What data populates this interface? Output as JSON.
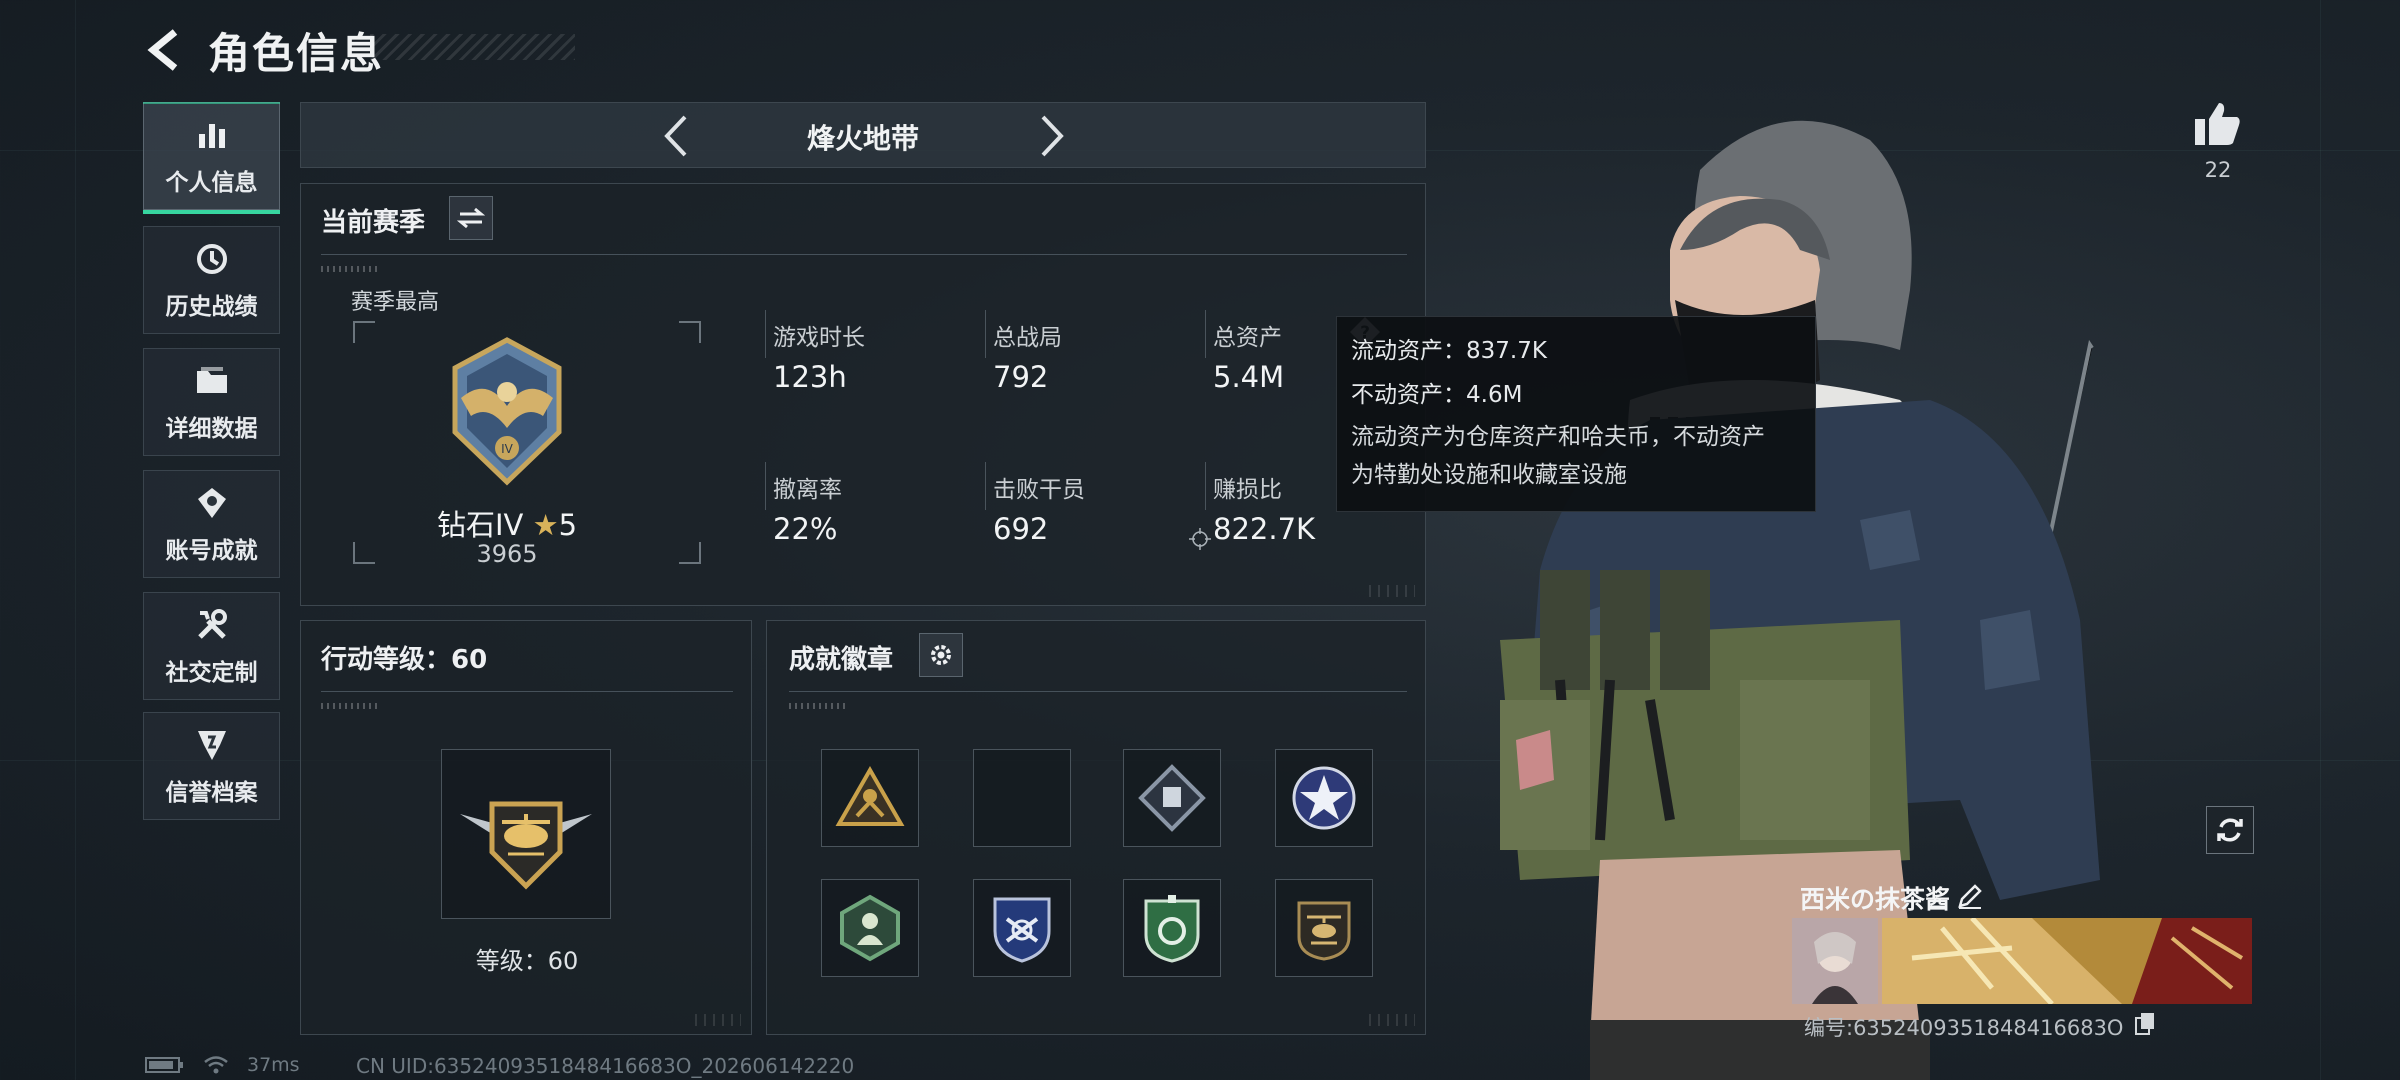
{
  "header": {
    "title": "角色信息"
  },
  "nav": {
    "items": [
      {
        "label": "个人信息",
        "icon": "bar-chart-icon",
        "active": true
      },
      {
        "label": "历史战绩",
        "icon": "clock-history-icon",
        "active": false
      },
      {
        "label": "详细数据",
        "icon": "folder-icon",
        "active": false
      },
      {
        "label": "账号成就",
        "icon": "achievement-icon",
        "active": false
      },
      {
        "label": "社交定制",
        "icon": "tools-icon",
        "active": false
      },
      {
        "label": "信誉档案",
        "icon": "reputation-icon",
        "active": false
      }
    ]
  },
  "mode": {
    "title": "烽火地带"
  },
  "season": {
    "title": "当前赛季",
    "best_label": "赛季最高",
    "rank_name": "钻石IV",
    "rank_stars": "5",
    "rank_score": "3965",
    "stats": [
      {
        "label": "游戏时长",
        "value": "123h"
      },
      {
        "label": "总战局",
        "value": "792"
      },
      {
        "label": "总资产",
        "value": "5.4M"
      },
      {
        "label": "撤离率",
        "value": "22%"
      },
      {
        "label": "击败干员",
        "value": "692"
      },
      {
        "label": "赚损比",
        "value": "822.7K"
      }
    ]
  },
  "tooltip": {
    "liquid": "流动资产：837.7K",
    "fixed": "不动资产：4.6M",
    "desc_line1": "流动资产为仓库资产和哈夫币，不动资产",
    "desc_line2": "为特勤处设施和收藏室设施"
  },
  "action_level": {
    "title": "行动等级：60",
    "level_text": "等级：60"
  },
  "badges": {
    "title": "成就徽章",
    "slots": [
      {
        "icon": "triangle-badge-icon",
        "color": "#c9a14a"
      },
      {
        "icon": "",
        "color": ""
      },
      {
        "icon": "diamond-badge-icon",
        "color": "#8a96a6"
      },
      {
        "icon": "star-badge-icon",
        "color": "#5a6fc4"
      },
      {
        "icon": "hexagon-badge-icon",
        "color": "#6fa77c"
      },
      {
        "icon": "shield-badge-icon",
        "color": "#4a66b8"
      },
      {
        "icon": "green-shield-badge-icon",
        "color": "#3f9b5c"
      },
      {
        "icon": "helicopter-badge-icon",
        "color": "#a88c54"
      }
    ]
  },
  "profile": {
    "likes": "22",
    "name": "西米の抹茶酱",
    "id_text": "编号:6352409351848416683O"
  },
  "status": {
    "ping": "37ms",
    "uid": "CN UID:6352409351848416683O_202606142220"
  },
  "colors": {
    "accent": "#37d6a0",
    "gold": "#d8b25a"
  }
}
